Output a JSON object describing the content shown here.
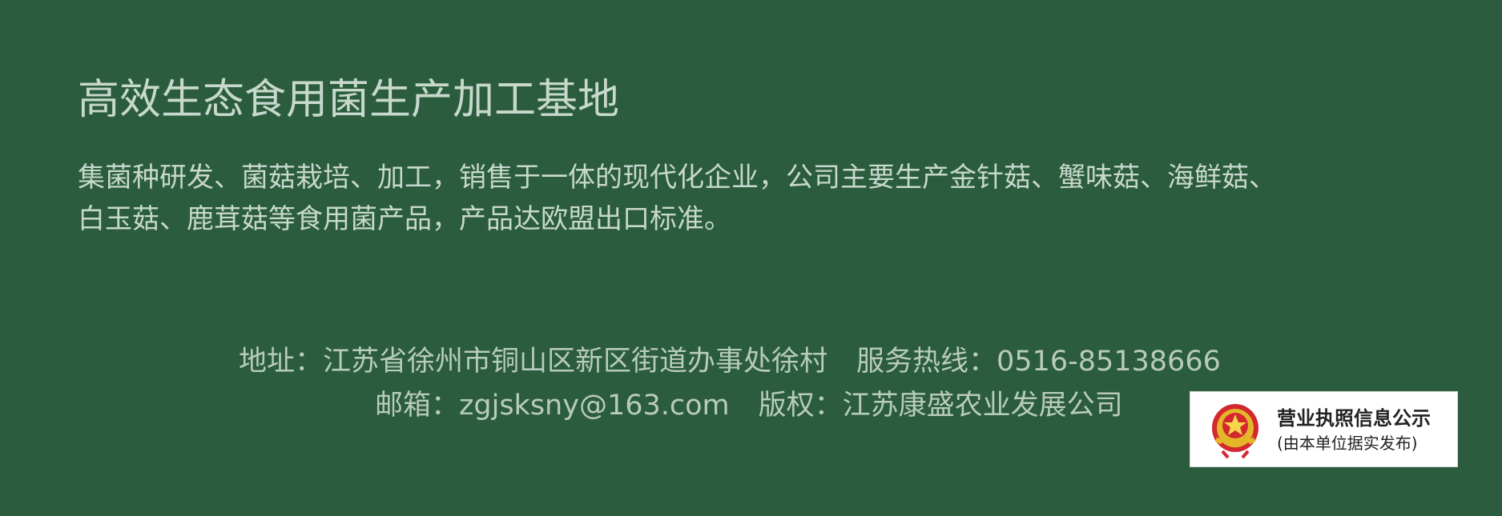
{
  "footer": {
    "title": "高效生态食用菌生产加工基地",
    "description_lines": [
      "集菌种研发、菌菇栽培、加工，销售于一体的现代化企业，公司主要生产金针菇、蟹味菇、海鲜菇、",
      "白玉菇、鹿茸菇等食用菌产品，产品达欧盟出口标准。"
    ],
    "address": "地址：江苏省徐州市铜山区新区街道办事处徐村",
    "hotline": "服务热线：0516-85138666",
    "email": "邮箱：zgjsksny@163.com",
    "copyright": "版权：江苏康盛农业发展公司"
  },
  "license_badge": {
    "title": "营业执照信息公示",
    "subtitle": "(由本单位据实发布)",
    "emblem_icon": "national-emblem-icon"
  },
  "colors": {
    "background": "#2a5c3d",
    "text": "#c7d8cc"
  }
}
